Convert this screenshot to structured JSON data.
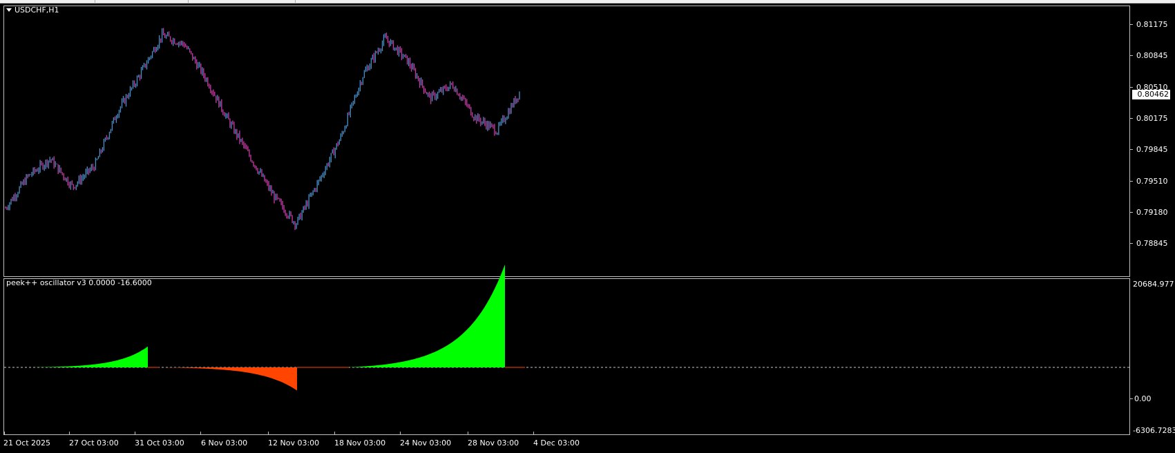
{
  "window": {
    "symbol_title": "USDCHF,H1",
    "dropdown_icon": "triangle-down-icon"
  },
  "price_axis": {
    "labels": [
      "0.81175",
      "0.80845",
      "0.80510",
      "0.80175",
      "0.79845",
      "0.79510",
      "0.79180",
      "0.78845"
    ],
    "current_price": "0.80462"
  },
  "oscillator": {
    "title": "peek++ oscillator v3 0.0000 -16.6000",
    "axis_labels": [
      "20684.977",
      "0.00",
      "-6306.7283"
    ]
  },
  "time_axis": {
    "labels": [
      "21 Oct 2025",
      "27 Oct 03:00",
      "31 Oct 03:00",
      "6 Nov 03:00",
      "12 Nov 03:00",
      "18 Nov 03:00",
      "24 Nov 03:00",
      "28 Nov 03:00",
      "4 Dec 03:00"
    ]
  },
  "colors": {
    "background": "#000000",
    "frame": "#c0c0c0",
    "bull_candle": "#4a8fc9",
    "bear_candle": "#c83aa8",
    "osc_positive": "#00ff00",
    "osc_negative": "#ff4500",
    "zero_line": "#c8c8c8"
  },
  "chart_data": [
    {
      "type": "line",
      "title": "USDCHF,H1",
      "x": [
        "21 Oct 2025",
        "23 Oct",
        "25 Oct",
        "27 Oct 03:00",
        "29 Oct",
        "31 Oct 03:00",
        "2 Nov",
        "4 Nov",
        "6 Nov 03:00",
        "8 Nov",
        "10 Nov",
        "12 Nov 03:00",
        "14 Nov",
        "16 Nov",
        "18 Nov 03:00",
        "20 Nov",
        "22 Nov",
        "24 Nov 03:00",
        "26 Nov",
        "28 Nov 03:00",
        "30 Nov",
        "2 Dec",
        "4 Dec 03:00",
        "5 Dec"
      ],
      "series": [
        {
          "values": [
            0.7922,
            0.7956,
            0.7975,
            0.7945,
            0.7968,
            0.8025,
            0.8065,
            0.8108,
            0.8098,
            0.806,
            0.8015,
            0.7975,
            0.7935,
            0.7905,
            0.795,
            0.7998,
            0.8065,
            0.8105,
            0.808,
            0.804,
            0.8055,
            0.802,
            0.8005,
            0.8046
          ]
        }
      ],
      "ylim": [
        0.7874,
        0.8137
      ],
      "grid": false
    },
    {
      "type": "area",
      "title": "peek++ oscillator v3 0.0000 -16.6000",
      "x": [
        "21 Oct 2025",
        "27 Oct 03:00",
        "31 Oct 03:00",
        "31 Oct",
        "6 Nov 03:00",
        "12 Nov 03:00",
        "13 Nov",
        "18 Nov 03:00",
        "20 Nov",
        "24 Nov 03:00",
        "28 Nov 03:00",
        "2 Dec",
        "4 Dec 03:00",
        "4 Dec"
      ],
      "series": [
        {
          "values": [
            0,
            600,
            4200,
            0,
            -500,
            -3200,
            -5300,
            0,
            150,
            1800,
            5500,
            12000,
            20685,
            0
          ]
        }
      ],
      "ylim": [
        -6306.7283,
        20684.977
      ],
      "grid": false
    }
  ]
}
